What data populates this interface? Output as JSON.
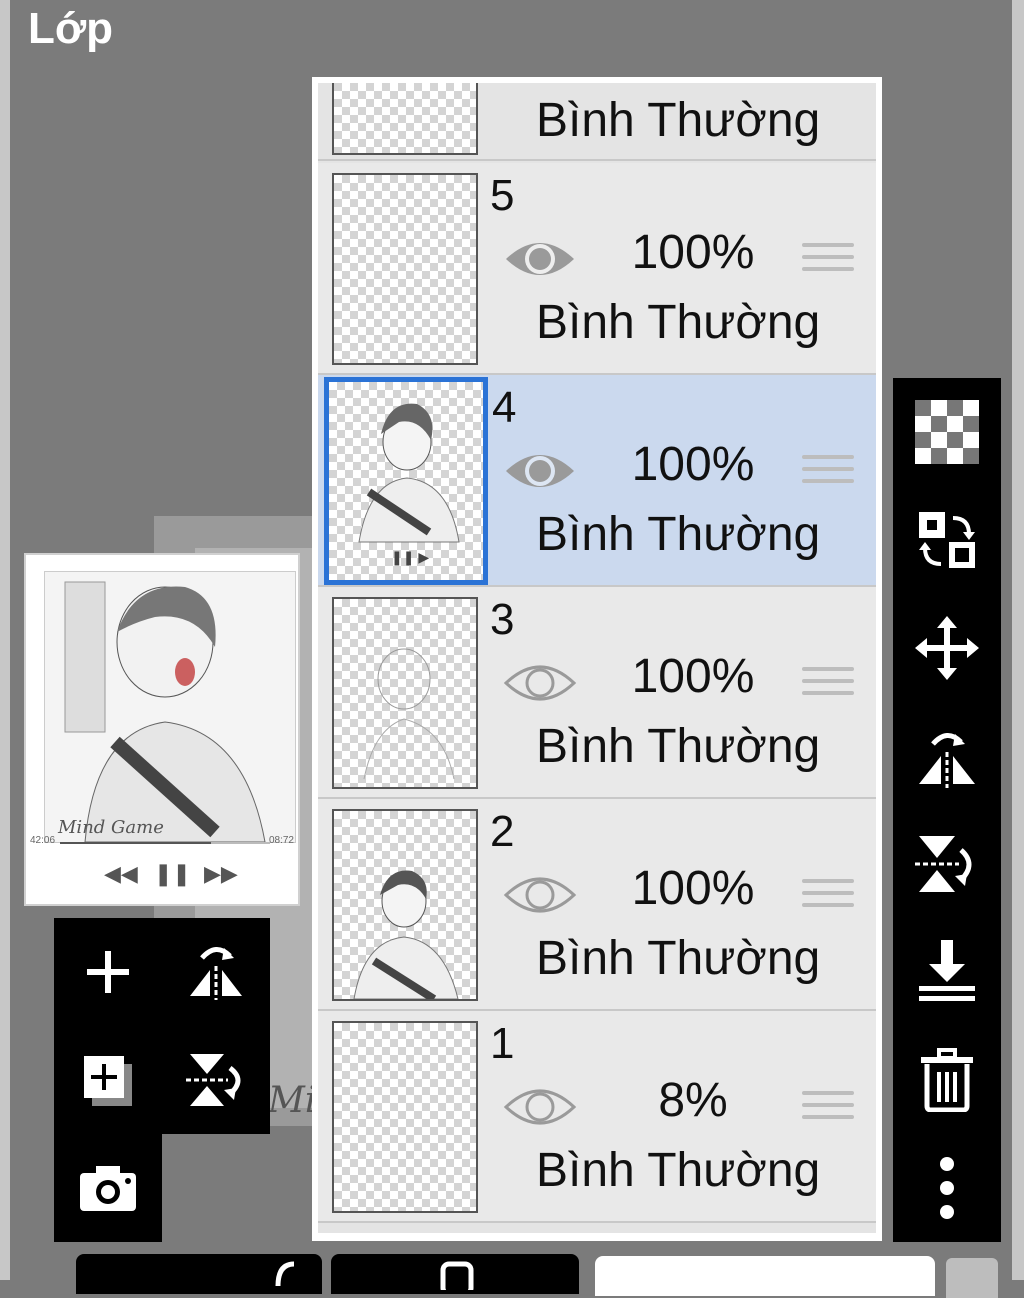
{
  "header": {
    "title": "Lớp"
  },
  "preview": {
    "caption": "Mind Game",
    "time_left": "42:06",
    "time_right": "08:72",
    "ghost_caption": "Mind",
    "progress": 0.72
  },
  "layers_panel": {
    "top_partial_blend": "Bình Thường",
    "layers": [
      {
        "number": "5",
        "visible": true,
        "opacity": "100%",
        "blend": "Bình Thường",
        "selected": false
      },
      {
        "number": "4",
        "visible": true,
        "opacity": "100%",
        "blend": "Bình Thường",
        "selected": true
      },
      {
        "number": "3",
        "visible": false,
        "opacity": "100%",
        "blend": "Bình Thường",
        "selected": false
      },
      {
        "number": "2",
        "visible": false,
        "opacity": "100%",
        "blend": "Bình Thường",
        "selected": false
      },
      {
        "number": "1",
        "visible": false,
        "opacity": "8%",
        "blend": "Bình Thường",
        "selected": false
      }
    ]
  },
  "left_tools": [
    "add-layer-icon",
    "flip-horizontal-icon",
    "add-layer-copy-icon",
    "flip-vertical-icon",
    "camera-icon"
  ],
  "right_tools": [
    "transparency-icon",
    "swap-layers-icon",
    "move-icon",
    "flip-horizontal-icon",
    "flip-vertical-icon",
    "merge-down-icon",
    "trash-icon",
    "more-icon"
  ],
  "colors": {
    "selected_bg": "#cbd9ee",
    "selected_border": "#2b73d6",
    "toolbar_bg": "#000000"
  }
}
